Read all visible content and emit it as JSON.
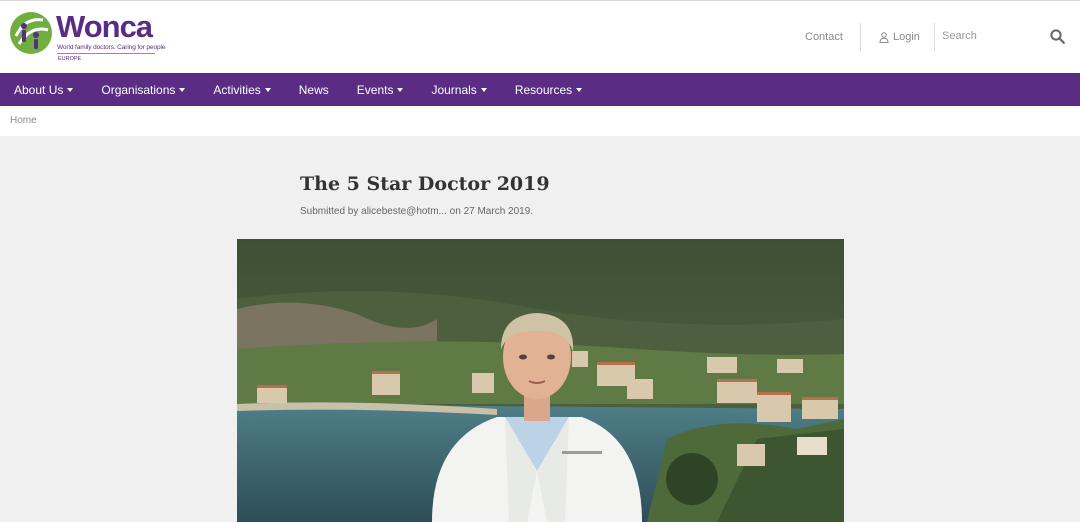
{
  "brand": {
    "name": "Wonca",
    "tagline": "World family doctors. Caring for people",
    "region": "EUROPE"
  },
  "utility": {
    "contact": "Contact",
    "login": "Login",
    "search_placeholder": "Search"
  },
  "nav": {
    "items": [
      {
        "label": "About Us",
        "dropdown": true
      },
      {
        "label": "Organisations",
        "dropdown": true
      },
      {
        "label": "Activities",
        "dropdown": true
      },
      {
        "label": "News",
        "dropdown": false
      },
      {
        "label": "Events",
        "dropdown": true
      },
      {
        "label": "Journals",
        "dropdown": true
      },
      {
        "label": "Resources",
        "dropdown": true
      }
    ]
  },
  "breadcrumb": {
    "home": "Home"
  },
  "article": {
    "title": "The 5 Star Doctor 2019",
    "submitted": "Submitted by alicebeste@hotm... on 27 March 2019."
  },
  "colors": {
    "brand_purple": "#5b2c83",
    "brand_green": "#6fae3f",
    "page_background": "#f0f0f0"
  },
  "icons": [
    "wonca-logo-icon",
    "user-icon",
    "search-icon",
    "caret-down-icon"
  ]
}
